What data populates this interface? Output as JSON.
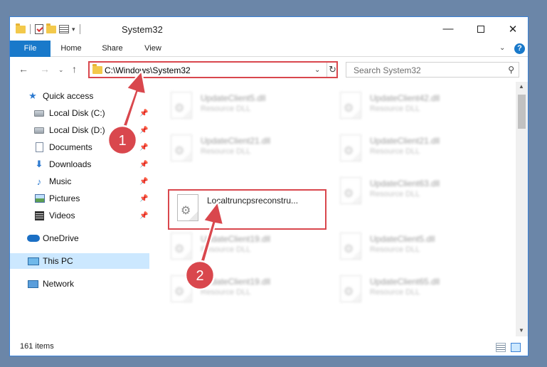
{
  "window": {
    "title": "System32"
  },
  "ribbon": {
    "tabs": [
      {
        "label": "File"
      },
      {
        "label": "Home"
      },
      {
        "label": "Share"
      },
      {
        "label": "View"
      }
    ],
    "help": "?"
  },
  "address": {
    "path": "C:\\Windows\\System32"
  },
  "search": {
    "placeholder": "Search System32"
  },
  "sidebar": {
    "items": [
      {
        "label": "Quick access",
        "icon": "star-icon"
      },
      {
        "label": "Local Disk (C:)",
        "icon": "disk-icon",
        "pinned": true
      },
      {
        "label": "Local Disk (D:)",
        "icon": "disk-icon",
        "pinned": true
      },
      {
        "label": "Documents",
        "icon": "documents-icon",
        "pinned": true
      },
      {
        "label": "Downloads",
        "icon": "download-icon",
        "pinned": true
      },
      {
        "label": "Music",
        "icon": "music-icon",
        "pinned": true
      },
      {
        "label": "Pictures",
        "icon": "pictures-icon",
        "pinned": true
      },
      {
        "label": "Videos",
        "icon": "videos-icon",
        "pinned": true
      },
      {
        "label": "OneDrive",
        "icon": "cloud-icon"
      },
      {
        "label": "This PC",
        "icon": "computer-icon",
        "selected": true
      },
      {
        "label": "Network",
        "icon": "network-icon"
      }
    ]
  },
  "files": [
    {
      "name": "UpdateClient5.dll",
      "type": "Resource DLL",
      "blurred": true
    },
    {
      "name": "UpdateClient42.dll",
      "type": "Resource DLL",
      "blurred": true
    },
    {
      "name": "UpdateClient21.dll",
      "type": "Resource DLL",
      "blurred": true
    },
    {
      "name": "UpdateClient21.dll",
      "type": "Resource DLL",
      "blurred": true
    },
    {
      "name": "Localtruncpsreconstru...",
      "type": "",
      "blurred": false
    },
    {
      "name": "UpdateClient63.dll",
      "type": "Resource DLL",
      "blurred": true
    },
    {
      "name": "UpdateClient19.dll",
      "type": "Resource DLL",
      "blurred": true
    },
    {
      "name": "UpdateClient5.dll",
      "type": "Resource DLL",
      "blurred": true
    },
    {
      "name": "UpdateClient19.dll",
      "type": "Resource DLL",
      "blurred": true
    },
    {
      "name": "UpdateClient65.dll",
      "type": "Resource DLL",
      "blurred": true
    }
  ],
  "status": {
    "item_count": "161 items"
  },
  "annotations": {
    "step1": "1",
    "step2": "2",
    "color": "#d9474d"
  },
  "colors": {
    "accent": "#1979ca",
    "selection": "#cce8ff",
    "highlight": "#d9474d"
  }
}
